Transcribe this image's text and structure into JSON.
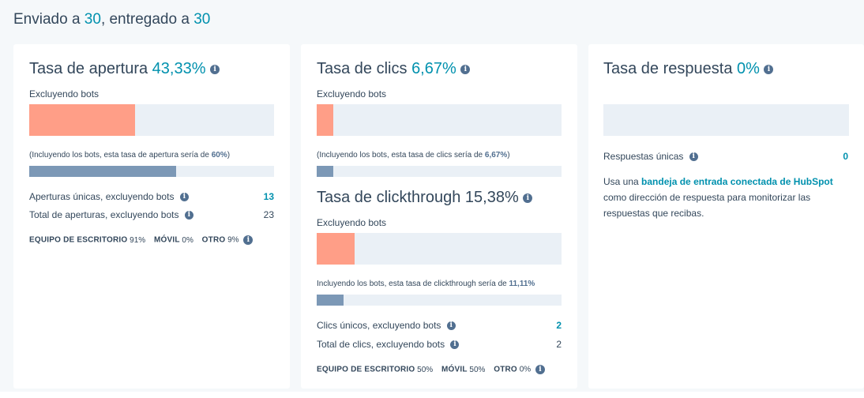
{
  "header": {
    "sent_label": "Enviado a",
    "sent_value": "30",
    "delivered_label": ", entregado a",
    "delivered_value": "30"
  },
  "open_card": {
    "title": "Tasa de apertura",
    "rate": "43,33%",
    "excl_label": "Excluyendo bots",
    "excl_rate_fraction": 0.4333,
    "incl_text_prefix": "(Incluyendo los bots, esta tasa de apertura sería de",
    "incl_value": "60%",
    "incl_text_suffix": ")",
    "incl_rate_fraction": 0.6,
    "stats": [
      {
        "label": "Aperturas únicas, excluyendo bots",
        "value": "13",
        "link": true
      },
      {
        "label": "Total de aperturas, excluyendo bots",
        "value": "23",
        "link": false
      }
    ],
    "devices": [
      {
        "label": "EQUIPO DE ESCRITORIO",
        "value": "91%"
      },
      {
        "label": "MÓVIL",
        "value": "0%"
      },
      {
        "label": "OTRO",
        "value": "9%"
      }
    ]
  },
  "click_card": {
    "title": "Tasa de clics",
    "rate": "6,67%",
    "excl_label": "Excluyendo bots",
    "excl_rate_fraction": 0.0667,
    "incl_text_prefix": "(Incluyendo los bots, esta tasa de clics sería de",
    "incl_value": "6,67%",
    "incl_text_suffix": ")",
    "incl_rate_fraction": 0.0667,
    "ct_title": "Tasa de clickthrough",
    "ct_rate": "15,38%",
    "ct_excl_label": "Excluyendo bots",
    "ct_excl_rate_fraction": 0.1538,
    "ct_incl_text_prefix": "Incluyendo los bots, esta tasa de clickthrough sería de",
    "ct_incl_value": "11,11%",
    "ct_incl_rate_fraction": 0.1111,
    "stats": [
      {
        "label": "Clics únicos, excluyendo bots",
        "value": "2",
        "link": true
      },
      {
        "label": "Total de clics, excluyendo bots",
        "value": "2",
        "link": false
      }
    ],
    "devices": [
      {
        "label": "EQUIPO DE ESCRITORIO",
        "value": "50%"
      },
      {
        "label": "MÓVIL",
        "value": "50%"
      },
      {
        "label": "OTRO",
        "value": "0%"
      }
    ]
  },
  "reply_card": {
    "title": "Tasa de respuesta",
    "rate": "0%",
    "rate_fraction": 0,
    "unique_label": "Respuestas únicas",
    "unique_value": "0",
    "text_prefix": "Usa una",
    "text_link": "bandeja de entrada conectada de HubSpot",
    "text_suffix": "como dirección de respuesta para monitorizar las respuestas que recibas."
  },
  "info_icon": "info-icon",
  "colors": {
    "accent": "#0091ae",
    "bar_primary": "#ff9e87",
    "bar_secondary": "#7c98b6",
    "bar_track": "#eaf0f6",
    "background": "#f5f8fa"
  }
}
